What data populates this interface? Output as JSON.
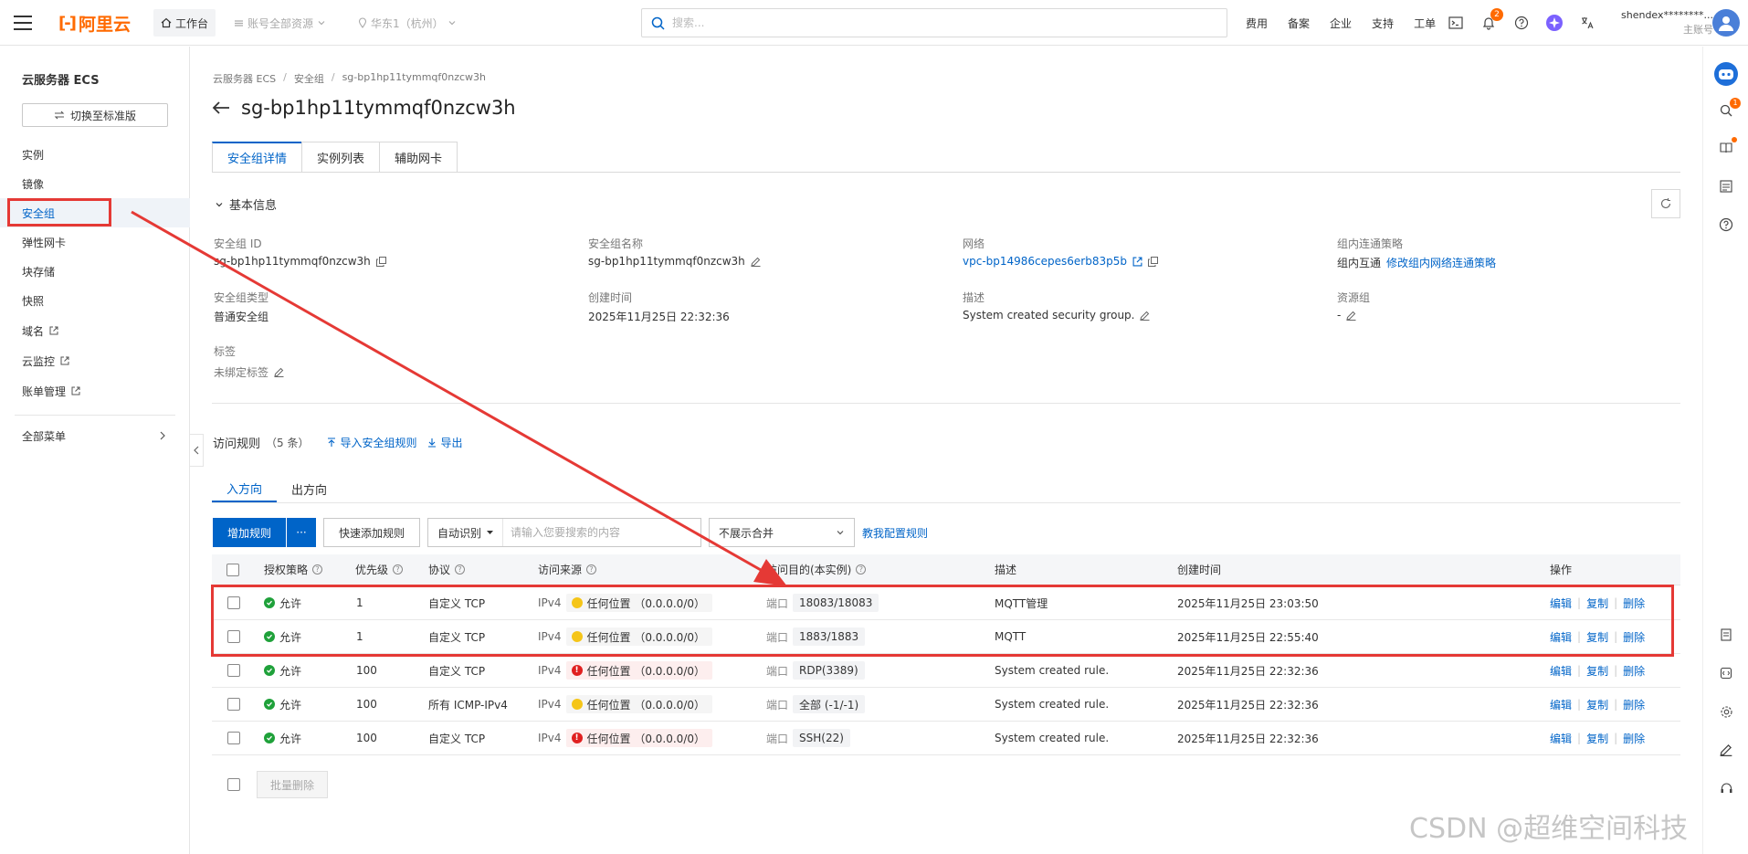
{
  "topbar": {
    "logo_text": "阿里云",
    "workbench": "工作台",
    "account_resources": "账号全部资源",
    "region": "华东1（杭州）",
    "search_placeholder": "搜索...",
    "menu": [
      "费用",
      "备案",
      "企业",
      "支持",
      "工单"
    ],
    "notification_count": "2",
    "username": "shendex********...",
    "user_role": "主账号"
  },
  "sidebar": {
    "title": "云服务器 ECS",
    "switch_label": "切换至标准版",
    "items": [
      {
        "label": "实例"
      },
      {
        "label": "镜像"
      },
      {
        "label": "安全组"
      },
      {
        "label": "弹性网卡"
      },
      {
        "label": "块存储"
      },
      {
        "label": "快照"
      },
      {
        "label": "域名"
      },
      {
        "label": "云监控"
      },
      {
        "label": "账单管理"
      }
    ],
    "all_menu": "全部菜单"
  },
  "breadcrumb": [
    "云服务器 ECS",
    "安全组",
    "sg-bp1hp11tymmqf0nzcw3h"
  ],
  "page_title": "sg-bp1hp11tymmqf0nzcw3h",
  "tabs": [
    "安全组详情",
    "实例列表",
    "辅助网卡"
  ],
  "basic_info": {
    "section_title": "基本信息",
    "fields": {
      "sg_id": {
        "label": "安全组 ID",
        "value": "sg-bp1hp11tymmqf0nzcw3h"
      },
      "sg_name": {
        "label": "安全组名称",
        "value": "sg-bp1hp11tymmqf0nzcw3h"
      },
      "network": {
        "label": "网络",
        "value": "vpc-bp14986cepes6erb83p5b"
      },
      "policy": {
        "label": "组内连通策略",
        "value": "组内互通",
        "link": "修改组内网络连通策略"
      },
      "sg_type": {
        "label": "安全组类型",
        "value": "普通安全组"
      },
      "created": {
        "label": "创建时间",
        "value": "2025年11月25日 22:32:36"
      },
      "desc": {
        "label": "描述",
        "value": "System created security group."
      },
      "resource_group": {
        "label": "资源组",
        "value": "-"
      },
      "tags": {
        "label": "标签",
        "value": "未绑定标签"
      }
    }
  },
  "rules": {
    "title": "访问规则",
    "count": "（5 条）",
    "import_link": "导入安全组规则",
    "export_link": "导出",
    "direction_tabs": [
      "入方向",
      "出方向"
    ],
    "toolbar": {
      "add_rule": "增加规则",
      "more": "···",
      "quick_add": "快速添加规则",
      "search_mode": "自动识别",
      "search_placeholder": "请输入您要搜索的内容",
      "merge": "不展示合并",
      "help_link": "教我配置规则"
    },
    "columns": {
      "policy": "授权策略",
      "priority": "优先级",
      "protocol": "协议",
      "source": "访问来源",
      "dest": "访问目的(本实例)",
      "desc": "描述",
      "created": "创建时间",
      "ops": "操作"
    },
    "rows": [
      {
        "policy": "允许",
        "priority": "1",
        "protocol": "自定义 TCP",
        "ipver": "IPv4",
        "source": "任何位置 （0.0.0.0/0）",
        "source_level": "warning",
        "port_prefix": "端口",
        "port": "18083/18083",
        "desc": "MQTT管理",
        "created": "2025年11月25日 23:03:50"
      },
      {
        "policy": "允许",
        "priority": "1",
        "protocol": "自定义 TCP",
        "ipver": "IPv4",
        "source": "任何位置 （0.0.0.0/0）",
        "source_level": "warning",
        "port_prefix": "端口",
        "port": "1883/1883",
        "desc": "MQTT",
        "created": "2025年11月25日 22:55:40"
      },
      {
        "policy": "允许",
        "priority": "100",
        "protocol": "自定义 TCP",
        "ipver": "IPv4",
        "source": "任何位置 （0.0.0.0/0）",
        "source_level": "danger",
        "port_prefix": "端口",
        "port": "RDP(3389)",
        "desc": "System created rule.",
        "created": "2025年11月25日 22:32:36"
      },
      {
        "policy": "允许",
        "priority": "100",
        "protocol": "所有 ICMP-IPv4",
        "ipver": "IPv4",
        "source": "任何位置 （0.0.0.0/0）",
        "source_level": "warning",
        "port_prefix": "端口",
        "port": "全部 (-1/-1)",
        "desc": "System created rule.",
        "created": "2025年11月25日 22:32:36"
      },
      {
        "policy": "允许",
        "priority": "100",
        "protocol": "自定义 TCP",
        "ipver": "IPv4",
        "source": "任何位置 （0.0.0.0/0）",
        "source_level": "danger",
        "port_prefix": "端口",
        "port": "SSH(22)",
        "desc": "System created rule.",
        "created": "2025年11月25日 22:32:36"
      }
    ],
    "ops": [
      "编辑",
      "复制",
      "删除"
    ],
    "batch_delete": "批量删除"
  },
  "watermark": "CSDN @超维空间科技",
  "colors": {
    "brand": "#ff6a00",
    "primary": "#0064c8",
    "allow": "#1fa13a",
    "warning": "#f5c518",
    "danger": "#e02020",
    "annotation": "#e53935"
  }
}
